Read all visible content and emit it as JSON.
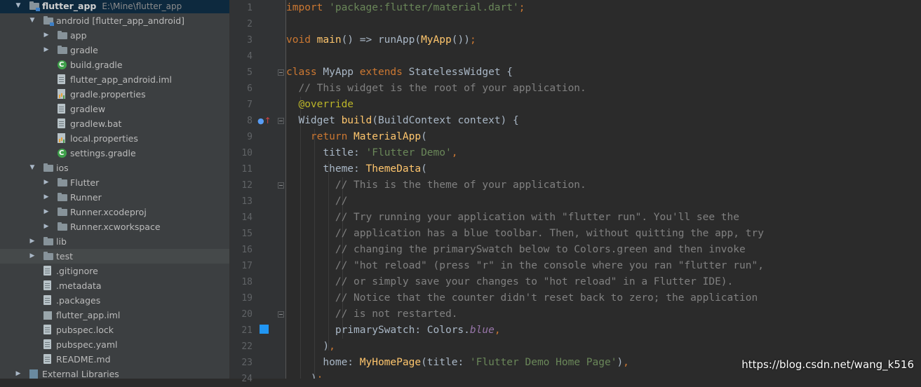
{
  "project_tree": [
    {
      "name": "flutter_app",
      "path": "E:\\Mine\\flutter_app",
      "level": 0,
      "arrow": "open",
      "icon": "module-folder-icon",
      "bold": true,
      "selected": true
    },
    {
      "name": "android [flutter_app_android]",
      "level": 1,
      "arrow": "open",
      "icon": "module-folder-icon"
    },
    {
      "name": "app",
      "level": 2,
      "arrow": "closed",
      "icon": "folder-icon"
    },
    {
      "name": "gradle",
      "level": 2,
      "arrow": "closed",
      "icon": "folder-icon"
    },
    {
      "name": "build.gradle",
      "level": 2,
      "icon": "gradle-icon"
    },
    {
      "name": "flutter_app_android.iml",
      "level": 2,
      "icon": "file-icon"
    },
    {
      "name": "gradle.properties",
      "level": 2,
      "icon": "properties-icon"
    },
    {
      "name": "gradlew",
      "level": 2,
      "icon": "file-icon"
    },
    {
      "name": "gradlew.bat",
      "level": 2,
      "icon": "file-icon"
    },
    {
      "name": "local.properties",
      "level": 2,
      "icon": "properties-icon"
    },
    {
      "name": "settings.gradle",
      "level": 2,
      "icon": "gradle-icon"
    },
    {
      "name": "ios",
      "level": 1,
      "arrow": "open",
      "icon": "folder-icon"
    },
    {
      "name": "Flutter",
      "level": 2,
      "arrow": "closed",
      "icon": "folder-icon"
    },
    {
      "name": "Runner",
      "level": 2,
      "arrow": "closed",
      "icon": "folder-icon"
    },
    {
      "name": "Runner.xcodeproj",
      "level": 2,
      "arrow": "closed",
      "icon": "folder-icon"
    },
    {
      "name": "Runner.xcworkspace",
      "level": 2,
      "arrow": "closed",
      "icon": "folder-icon"
    },
    {
      "name": "lib",
      "level": 1,
      "arrow": "closed",
      "icon": "folder-icon"
    },
    {
      "name": "test",
      "level": 1,
      "arrow": "closed",
      "icon": "folder-icon",
      "highlighted": true
    },
    {
      "name": ".gitignore",
      "level": 1,
      "icon": "file-icon"
    },
    {
      "name": ".metadata",
      "level": 1,
      "icon": "file-icon"
    },
    {
      "name": ".packages",
      "level": 1,
      "icon": "file-icon"
    },
    {
      "name": "flutter_app.iml",
      "level": 1,
      "icon": "iml-icon"
    },
    {
      "name": "pubspec.lock",
      "level": 1,
      "icon": "file-icon"
    },
    {
      "name": "pubspec.yaml",
      "level": 1,
      "icon": "file-icon"
    },
    {
      "name": "README.md",
      "level": 1,
      "icon": "file-icon"
    },
    {
      "name": "External Libraries",
      "level": 0,
      "arrow": "closed",
      "icon": "libraries-icon"
    }
  ],
  "gutter": {
    "line_numbers": [
      "1",
      "2",
      "3",
      "4",
      "5",
      "6",
      "7",
      "8",
      "9",
      "10",
      "11",
      "12",
      "13",
      "14",
      "15",
      "16",
      "17",
      "18",
      "19",
      "20",
      "21",
      "22",
      "23",
      "24"
    ],
    "fold_markers_lines": [
      5,
      8,
      12,
      20
    ],
    "override_marker_line": 8,
    "color_swatch_line": 21,
    "color_swatch": "#2196f3"
  },
  "code_lines": [
    [
      [
        "kw",
        "import "
      ],
      [
        "str",
        "'package:flutter/material.dart'"
      ],
      [
        "kw",
        ";"
      ]
    ],
    [],
    [
      [
        "kw",
        "void "
      ],
      [
        "fn",
        "main"
      ],
      [
        "txt",
        "() => runApp("
      ],
      [
        "fn",
        "MyApp"
      ],
      [
        "txt",
        "())"
      ],
      [
        "kw",
        ";"
      ]
    ],
    [],
    [
      [
        "kw",
        "class "
      ],
      [
        "txt",
        "MyApp "
      ],
      [
        "kw",
        "extends "
      ],
      [
        "txt",
        "StatelessWidget {"
      ]
    ],
    [
      [
        "cm",
        "  // This widget is the root of your application."
      ]
    ],
    [
      [
        "an",
        "  @override"
      ]
    ],
    [
      [
        "txt",
        "  Widget "
      ],
      [
        "fn",
        "build"
      ],
      [
        "txt",
        "(BuildContext context) {"
      ]
    ],
    [
      [
        "kw",
        "    return "
      ],
      [
        "fn",
        "MaterialApp"
      ],
      [
        "txt",
        "("
      ]
    ],
    [
      [
        "txt",
        "      title: "
      ],
      [
        "str",
        "'Flutter Demo'"
      ],
      [
        "kw",
        ","
      ]
    ],
    [
      [
        "txt",
        "      theme: "
      ],
      [
        "fn",
        "ThemeData"
      ],
      [
        "txt",
        "("
      ]
    ],
    [
      [
        "cm",
        "        // This is the theme of your application."
      ]
    ],
    [
      [
        "cm",
        "        //"
      ]
    ],
    [
      [
        "cm",
        "        // Try running your application with \"flutter run\". You'll see the"
      ]
    ],
    [
      [
        "cm",
        "        // application has a blue toolbar. Then, without quitting the app, try"
      ]
    ],
    [
      [
        "cm",
        "        // changing the primarySwatch below to Colors.green and then invoke"
      ]
    ],
    [
      [
        "cm",
        "        // \"hot reload\" (press \"r\" in the console where you ran \"flutter run\","
      ]
    ],
    [
      [
        "cm",
        "        // or simply save your changes to \"hot reload\" in a Flutter IDE)."
      ]
    ],
    [
      [
        "cm",
        "        // Notice that the counter didn't reset back to zero; the application"
      ]
    ],
    [
      [
        "cm",
        "        // is not restarted."
      ]
    ],
    [
      [
        "txt",
        "        primarySwatch: Colors."
      ],
      [
        "pm",
        "blue"
      ],
      [
        "kw",
        ","
      ]
    ],
    [
      [
        "txt",
        "      )"
      ],
      [
        "kw",
        ","
      ]
    ],
    [
      [
        "txt",
        "      home: "
      ],
      [
        "fn",
        "MyHomePage"
      ],
      [
        "txt",
        "(title: "
      ],
      [
        "str",
        "'Flutter Demo Home Page'"
      ],
      [
        "txt",
        ")"
      ],
      [
        "kw",
        ","
      ]
    ],
    [
      [
        "txt",
        "    )"
      ],
      [
        "kw",
        ";"
      ]
    ]
  ],
  "watermark": "https://blog.csdn.net/wang_k516",
  "colors": {
    "editor_bg": "#2b2b2b",
    "panel_bg": "#3c3f41",
    "gutter_bg": "#313335",
    "selection": "#0d293e",
    "keyword": "#cc7832",
    "string": "#6a8759",
    "function": "#ffc66d",
    "comment": "#808080",
    "annotation": "#bbb529",
    "constant": "#9876aa",
    "text": "#a9b7c6"
  }
}
